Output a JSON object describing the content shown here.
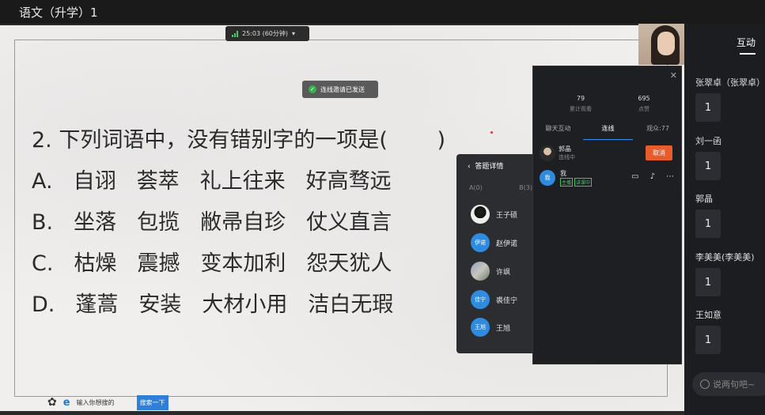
{
  "window": {
    "title": "语文（升学）1"
  },
  "timer": {
    "label": "25:03 (60分钟)"
  },
  "toast": {
    "label": "连线邀请已发送"
  },
  "slide": {
    "question": "2. 下列词语中，没有错别字的一项是(　　 )",
    "options": [
      {
        "letter": "A.",
        "words": [
          "自诩",
          "荟萃",
          "礼上往来",
          "好高骛远"
        ]
      },
      {
        "letter": "B.",
        "words": [
          "坐落",
          "包揽",
          "敝帚自珍",
          "仗义直言"
        ]
      },
      {
        "letter": "C.",
        "words": [
          "枯燥",
          "震撼",
          "变本加利",
          "怨天犹人"
        ]
      },
      {
        "letter": "D.",
        "words": [
          "蓬蒿",
          "安装",
          "大材小用",
          "洁白无瑕"
        ]
      }
    ],
    "bottom": {
      "search_placeholder": "输入你想搜的",
      "search_button": "搜索一下"
    }
  },
  "answers_panel": {
    "title": "答题详情",
    "tab_a": "A(0)",
    "tab_b": "B(3)",
    "students": [
      {
        "avatar": "",
        "name": "王子硕"
      },
      {
        "avatar": "伊诺",
        "name": "赵伊诺"
      },
      {
        "avatar": "",
        "name": "许飒"
      },
      {
        "avatar": "佳宁",
        "name": "裘佳宁"
      },
      {
        "avatar": "王旭",
        "name": "王旭"
      }
    ]
  },
  "live_panel": {
    "stats": [
      {
        "value": "79",
        "label": "累计观看"
      },
      {
        "value": "695",
        "label": "点赞"
      }
    ],
    "tabs": [
      "聊天互动",
      "连线",
      "观众:77"
    ],
    "caller": {
      "name": "郭晶",
      "status": "连线中",
      "cancel": "取消"
    },
    "me": {
      "avatar": "我",
      "name": "我",
      "tag1": "主播",
      "tag2": "讲课中"
    }
  },
  "sidebar": {
    "tab": "互动",
    "messages": [
      {
        "name": "张翠卓（张翠卓）",
        "text": "1"
      },
      {
        "name": "刘一函",
        "text": "1"
      },
      {
        "name": "郭晶",
        "text": "1"
      },
      {
        "name": "李美美(李美美)",
        "text": "1"
      },
      {
        "name": "王如意",
        "text": "1"
      }
    ],
    "input_placeholder": "说两句吧~"
  }
}
